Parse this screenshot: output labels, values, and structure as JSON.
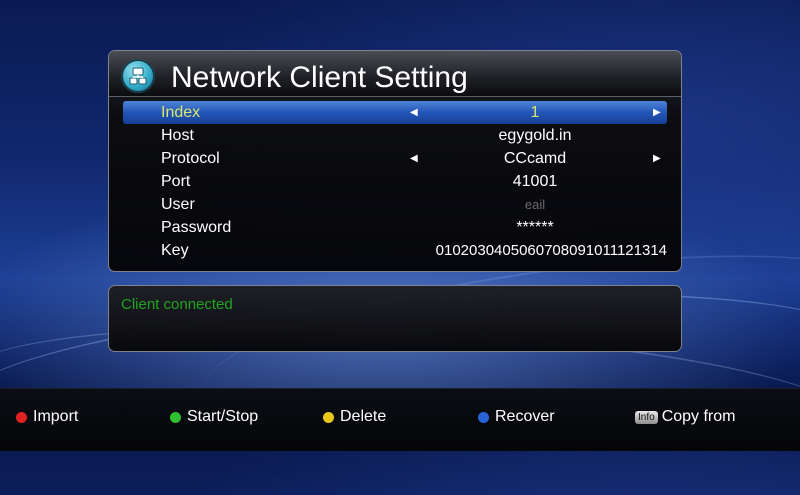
{
  "title": "Network Client Setting",
  "rows": [
    {
      "label": "Index",
      "value": "1"
    },
    {
      "label": "Host",
      "value": "egygold.in"
    },
    {
      "label": "Protocol",
      "value": "CCcamd"
    },
    {
      "label": "Port",
      "value": "41001"
    },
    {
      "label": "User",
      "value": "eail"
    },
    {
      "label": "Password",
      "value": "******"
    },
    {
      "label": "Key",
      "value": "0102030405060708091011121314"
    }
  ],
  "message": "Client connected",
  "footer": {
    "import": "Import",
    "start_stop": "Start/Stop",
    "delete": "Delete",
    "recover": "Recover",
    "info_badge": "Info",
    "copy_from": "Copy from"
  },
  "colors": {
    "highlight": "#2456b8",
    "selected_text": "#d8e86a",
    "message_text": "#1fa51f",
    "red": "#e02222",
    "green": "#2fbf2f",
    "yellow": "#e8c71a",
    "blue": "#2a63d8"
  }
}
